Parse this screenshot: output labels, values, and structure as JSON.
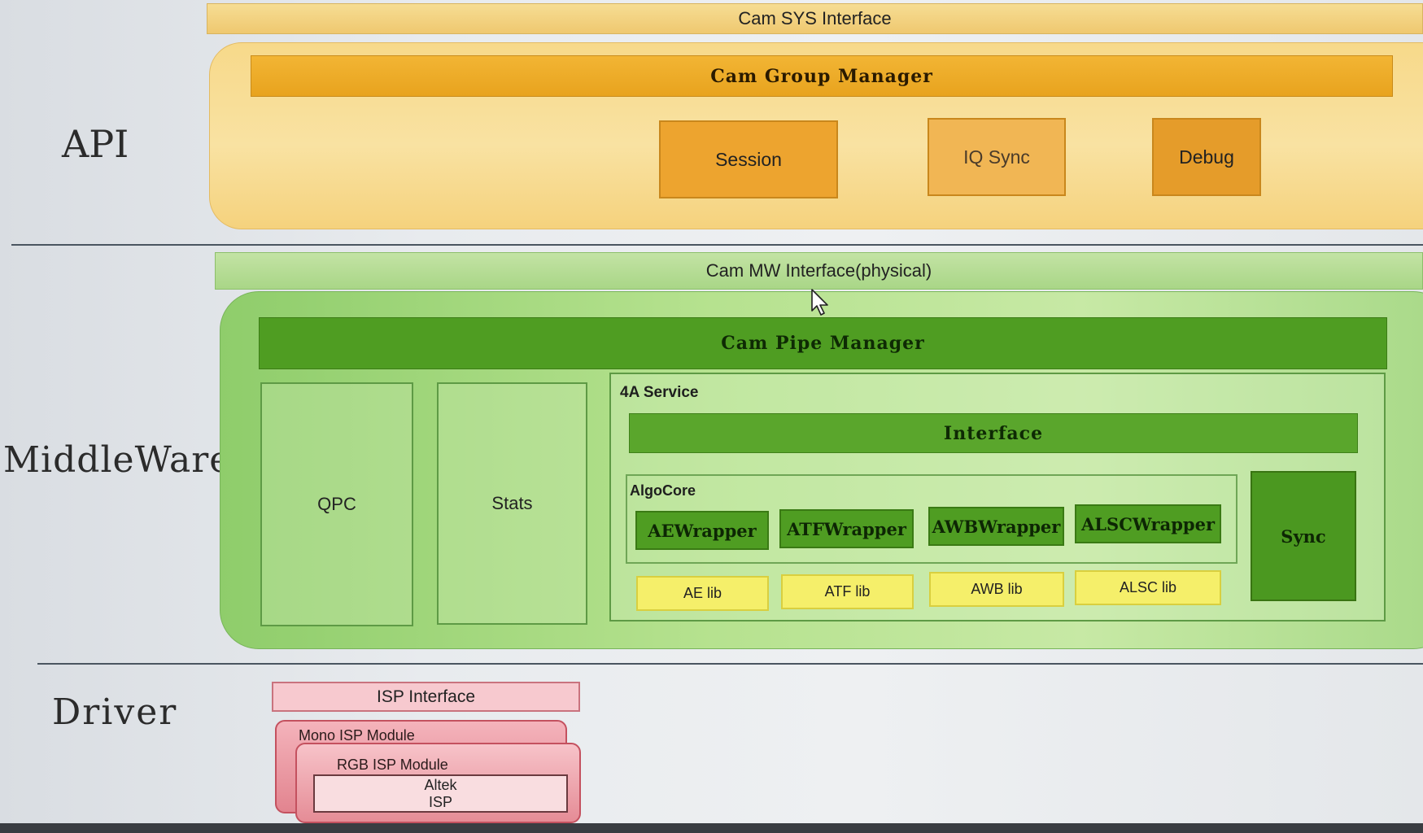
{
  "layers": {
    "api": "API",
    "middleware": "MiddleWare",
    "driver": "Driver"
  },
  "api": {
    "sys_interface": "Cam SYS Interface",
    "group_manager": "Cam Group Manager",
    "session": "Session",
    "iq_sync": "IQ Sync",
    "debug": "Debug"
  },
  "middleware": {
    "mw_interface": "Cam MW Interface(physical)",
    "pipe_manager": "Cam Pipe Manager",
    "qpc": "QPC",
    "stats": "Stats",
    "service": {
      "title": "4A Service",
      "interface": "Interface",
      "algocore": {
        "title": "AlgoCore",
        "wrappers": [
          "AEWrapper",
          "ATFWrapper",
          "AWBWrapper",
          "ALSCWrapper"
        ]
      },
      "libs": [
        "AE lib",
        "ATF lib",
        "AWB lib",
        "ALSC lib"
      ],
      "sync": "Sync"
    }
  },
  "driver": {
    "isp_interface": "ISP Interface",
    "mono_module": "Mono ISP Module",
    "rgb_module": "RGB ISP Module",
    "altek_line1": "Altek",
    "altek_line2": "ISP"
  },
  "colors": {
    "api": "#f7d98a",
    "middleware": "#8fcd6b",
    "driver": "#f4b3bb"
  },
  "icons": {
    "cursor": "mouse-pointer-icon"
  }
}
